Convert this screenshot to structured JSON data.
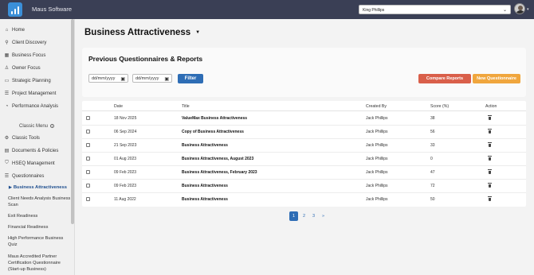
{
  "app": {
    "title": "Maus Software"
  },
  "user": {
    "selected": "King Phillips"
  },
  "sidebar": {
    "items": [
      {
        "label": "Home",
        "icon": "home-icon"
      },
      {
        "label": "Client Discovery",
        "icon": "search-icon"
      },
      {
        "label": "Business Focus",
        "icon": "chart-icon"
      },
      {
        "label": "Owner Focus",
        "icon": "user-icon"
      },
      {
        "label": "Strategic Planning",
        "icon": "board-icon"
      },
      {
        "label": "Project Management",
        "icon": "list-icon"
      },
      {
        "label": "Performance Analysis",
        "icon": "analysis-icon"
      }
    ],
    "classic_menu_label": "Classic Menu",
    "classic_items": [
      {
        "label": "Classic Tools",
        "icon": "gear-icon"
      },
      {
        "label": "Documents & Policies",
        "icon": "document-icon"
      },
      {
        "label": "HSEQ Management",
        "icon": "shield-icon"
      },
      {
        "label": "Questionnaires",
        "icon": "list-icon"
      }
    ],
    "sub_items": {
      "active": "Business Attractiveness",
      "client_needs": "Client Needs Analysis Business Scan",
      "exit_readiness": "Exit Readiness",
      "financial_readiness": "Financial Readiness",
      "high_performance": "High Performance Business Quiz",
      "accredited_partner": "Maus Accredited Partner Certification Questionnaire (Start-up Business)"
    }
  },
  "page": {
    "title": "Business Attractiveness",
    "section_title": "Previous Questionnaires & Reports",
    "date_from_placeholder": "dd/mm/yyyy",
    "date_to_placeholder": "dd/mm/yyyy",
    "filter_label": "Filter",
    "compare_label": "Compare Reports",
    "new_label": "New Questionnaire"
  },
  "table": {
    "headers": {
      "date": "Date",
      "title": "Title",
      "created_by": "Created By",
      "score": "Score (%)",
      "action": "Action"
    },
    "rows": [
      {
        "date": "18 Nov 2025",
        "title": "ValueMax Business Attractiveness",
        "created_by": "Jack Phillips",
        "score": "38"
      },
      {
        "date": "06 Sep 2024",
        "title": "Copy of Business Attractiveness",
        "created_by": "Jack Phillips",
        "score": "56"
      },
      {
        "date": "21 Sep 2023",
        "title": "Business Attractiveness",
        "created_by": "Jack Phillips",
        "score": "33"
      },
      {
        "date": "01 Aug 2023",
        "title": "Business Attractiveness, August 2023",
        "created_by": "Jack Phillips",
        "score": "0"
      },
      {
        "date": "09 Feb 2023",
        "title": "Business Attractiveness, February 2023",
        "created_by": "Jack Phillips",
        "score": "47"
      },
      {
        "date": "09 Feb 2023",
        "title": "Business Attractiveness",
        "created_by": "Jack Phillips",
        "score": "72"
      },
      {
        "date": "11 Aug 2022",
        "title": "Business Attractiveness",
        "created_by": "Jack Phillips",
        "score": "50"
      }
    ]
  },
  "pagination": {
    "pages": [
      "1",
      "2",
      "3"
    ],
    "next": "»",
    "current": "1"
  },
  "colors": {
    "topbar": "#3a3f55",
    "primary": "#2e6db5",
    "compare": "#d95f4a",
    "new": "#f0a63d"
  }
}
